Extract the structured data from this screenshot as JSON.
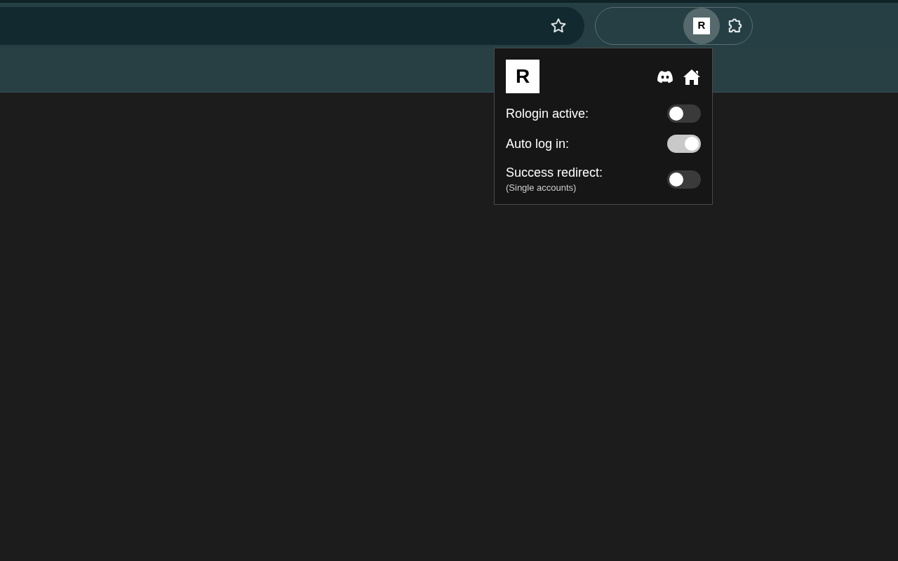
{
  "toolbar": {
    "extension_badge": "R"
  },
  "popup": {
    "logo": "R",
    "settings": [
      {
        "label": "Rologin active:",
        "on": false
      },
      {
        "label": "Auto log in:",
        "on": true
      },
      {
        "label": "Success redirect:",
        "note": "(Single accounts)",
        "on": false
      }
    ]
  }
}
